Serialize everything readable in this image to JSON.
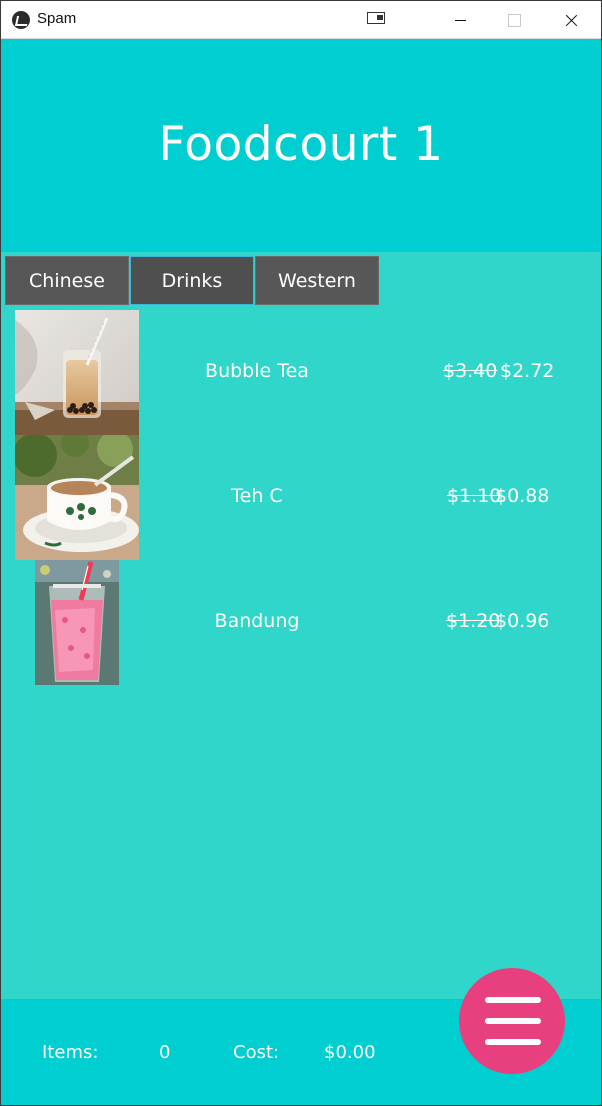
{
  "window": {
    "title": "Spam",
    "icons": {
      "app": "kivy-logo-icon",
      "snap": "snap-layout-icon",
      "minimize": "minimize-icon",
      "maximize": "maximize-icon",
      "close": "close-icon"
    }
  },
  "header": {
    "title": "Foodcourt 1",
    "color": "#00ced0"
  },
  "tabs": [
    {
      "label": "Chinese",
      "active": false
    },
    {
      "label": "Drinks",
      "active": true
    },
    {
      "label": "Western",
      "active": false
    }
  ],
  "items": [
    {
      "name": "Bubble Tea",
      "old_price": "$3.40",
      "new_price": "$2.72",
      "image": "bubble-tea-photo"
    },
    {
      "name": "Teh C",
      "old_price": "$1.10",
      "new_price": "$0.88",
      "image": "teh-c-photo"
    },
    {
      "name": "Bandung",
      "old_price": "$1.20",
      "new_price": "$0.96",
      "image": "bandung-photo"
    }
  ],
  "footer": {
    "items_label": "Items:",
    "items_value": "0",
    "cost_label": "Cost:",
    "cost_value": "$0.00"
  },
  "fab": {
    "icon": "hamburger-menu-icon",
    "color": "#e83f7f"
  },
  "colors": {
    "background": "#2fd6c9",
    "tab_bg": "#575757"
  }
}
